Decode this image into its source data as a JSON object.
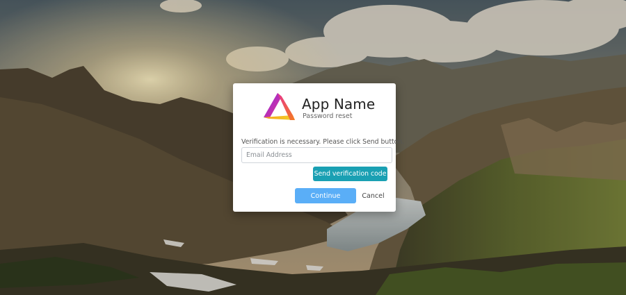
{
  "app": {
    "name": "App Name",
    "subtitle": "Password reset"
  },
  "logo": {
    "icon": "triangle-logo-icon"
  },
  "form": {
    "instruction": "Verification is necessary. Please click Send button.",
    "email_placeholder": "Email Address",
    "email_value": "",
    "send_label": "Send verification code",
    "continue_label": "Continue",
    "cancel_label": "Cancel"
  },
  "colors": {
    "send_button": "#1aa0b3",
    "continue_button": "#5aaef7",
    "card_background": "#ffffff"
  }
}
